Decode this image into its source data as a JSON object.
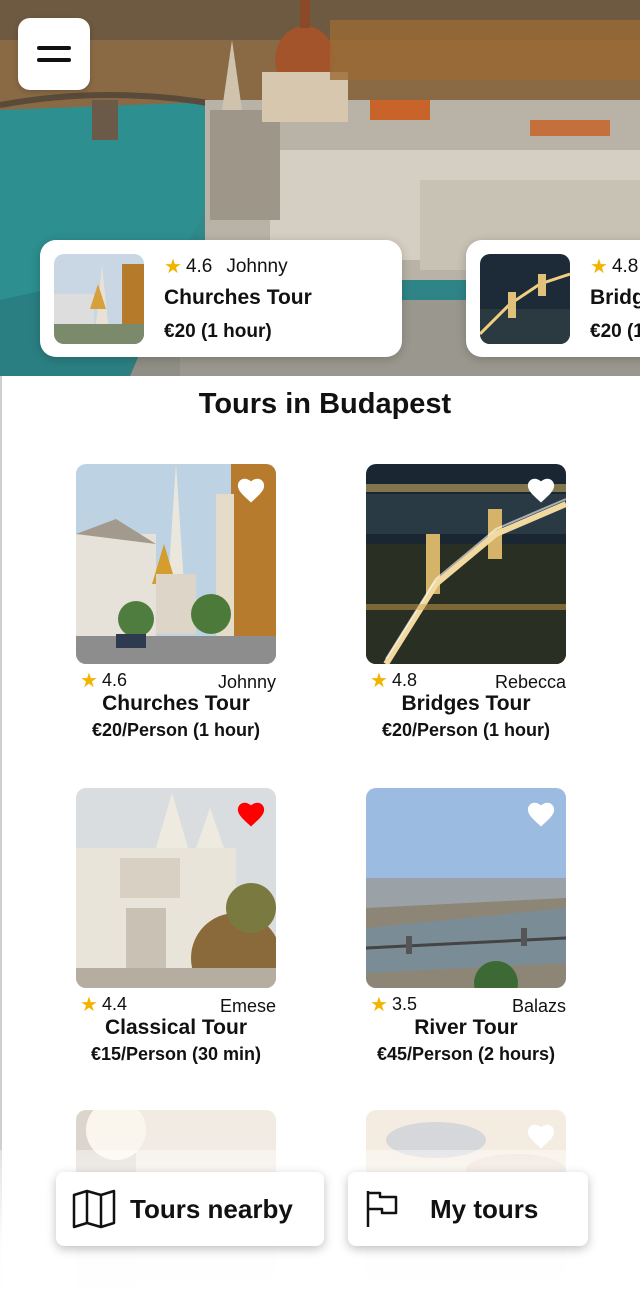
{
  "hero": {
    "menu_icon": "hamburger-menu-icon",
    "featured": [
      {
        "rating": "4.6",
        "author": "Johnny",
        "title": "Churches Tour",
        "price": "€20 (1 hour)"
      },
      {
        "rating": "4.8",
        "author": "",
        "title": "Bridg",
        "price": "€20 (1"
      }
    ]
  },
  "section": {
    "title": "Tours in Budapest"
  },
  "tours": [
    {
      "rating": "4.6",
      "author": "Johnny",
      "title": "Churches Tour",
      "price": "€20/Person (1 hour)",
      "favorite": false
    },
    {
      "rating": "4.8",
      "author": "Rebecca",
      "title": "Bridges Tour",
      "price": "€20/Person (1 hour)",
      "favorite": false
    },
    {
      "rating": "4.4",
      "author": "Emese",
      "title": "Classical Tour",
      "price": "€15/Person (30 min)",
      "favorite": true
    },
    {
      "rating": "3.5",
      "author": "Balazs",
      "title": "River Tour",
      "price": "€45/Person (2 hours)",
      "favorite": false
    }
  ],
  "actions": {
    "nearby_label": "Tours nearby",
    "nearby_icon": "map-icon",
    "mytours_label": "My tours",
    "mytours_icon": "flag-icon"
  },
  "colors": {
    "star": "#f3b400",
    "heart_active": "#ff0000",
    "heart_inactive": "#ffffff"
  }
}
